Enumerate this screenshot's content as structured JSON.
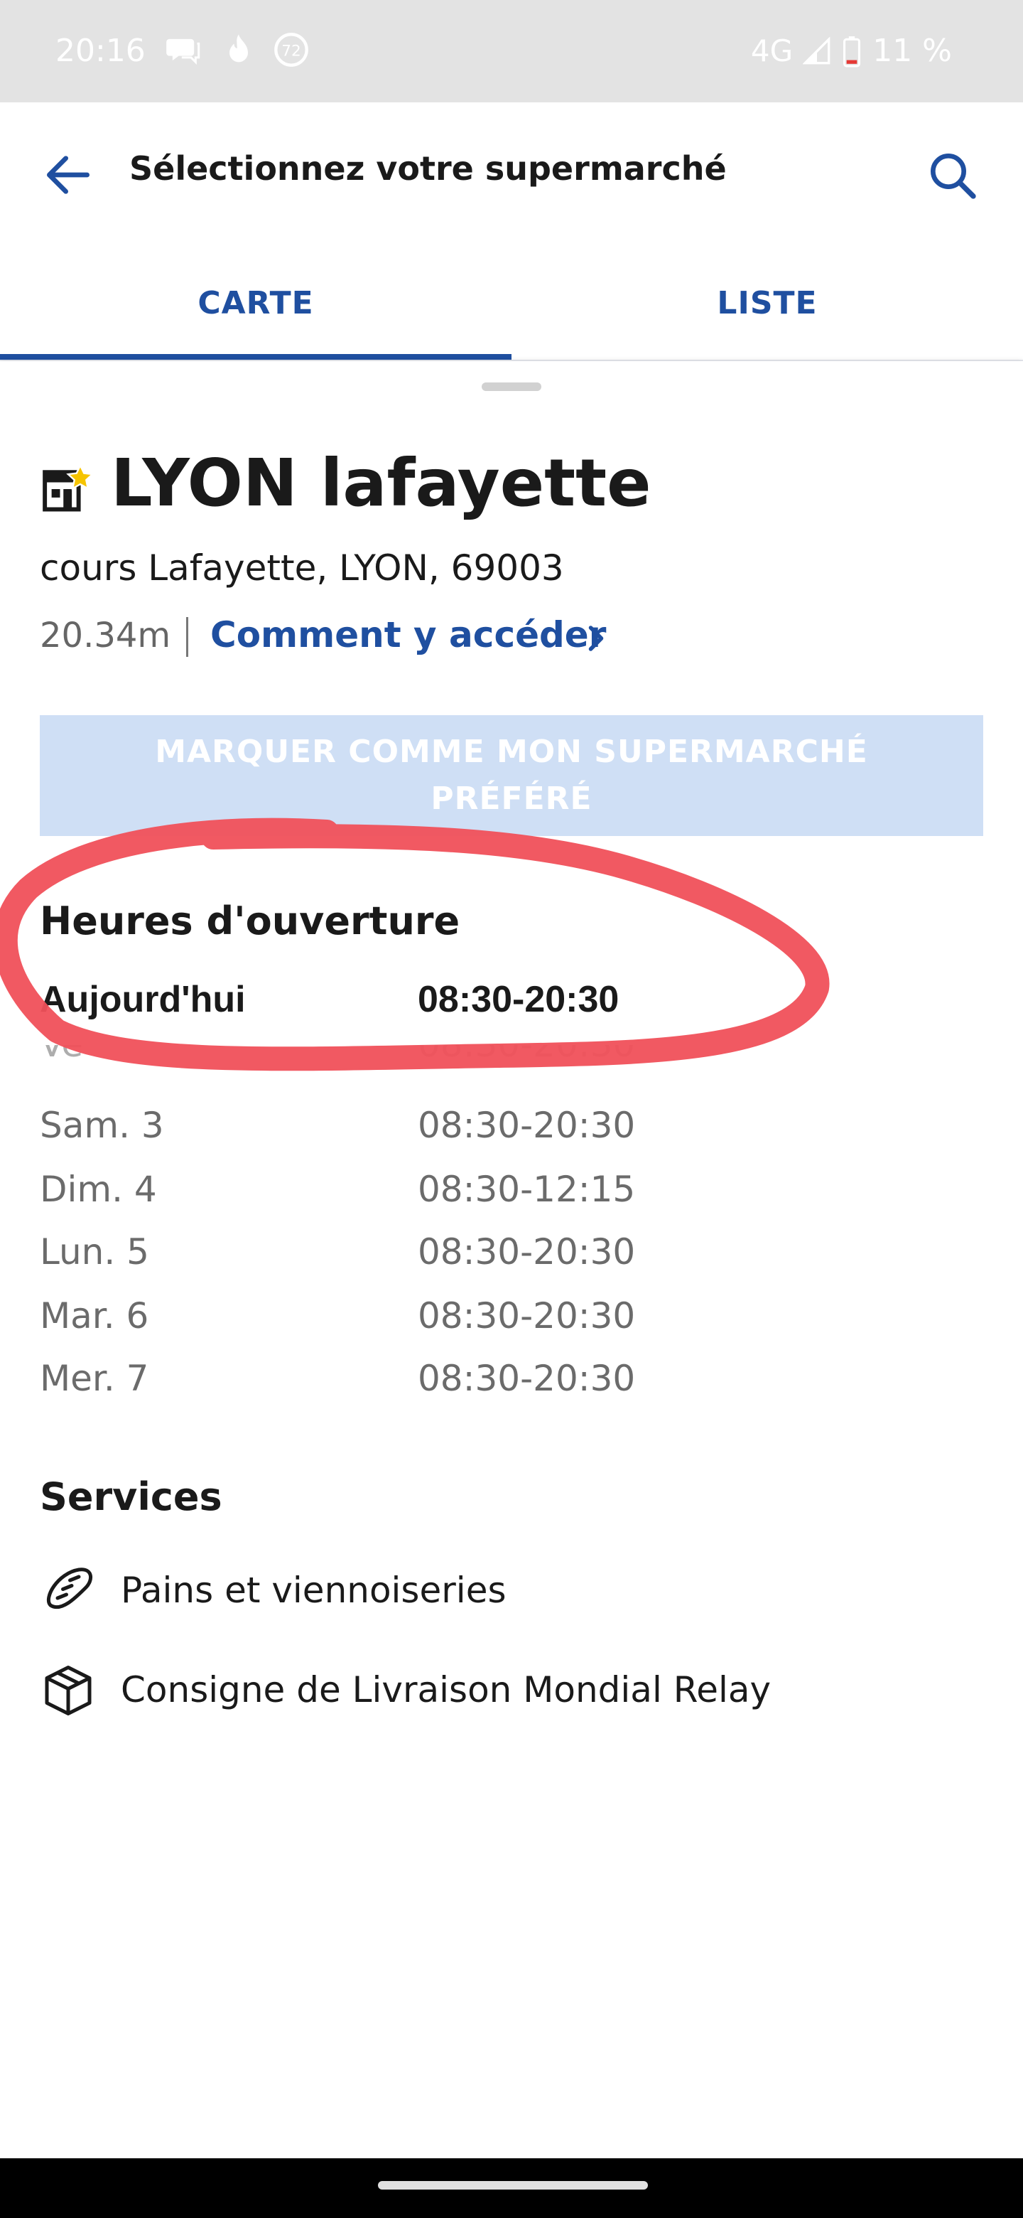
{
  "status_bar": {
    "time": "20:16",
    "notification_badge": "72",
    "network": "4G",
    "battery": "11 %"
  },
  "app_bar": {
    "title": "Sélectionnez votre supermarché"
  },
  "tabs": [
    {
      "label": "CARTE",
      "active": true
    },
    {
      "label": "LISTE",
      "active": false
    }
  ],
  "store": {
    "name": "LYON lafayette",
    "address": "cours Lafayette, LYON, 69003",
    "distance": "20.34m",
    "directions_label": "Comment y accéder",
    "favorite_button_label": "MARQUER COMME MON SUPERMARCHÉ PRÉFÉRÉ"
  },
  "hours": {
    "title": "Heures d'ouverture",
    "rows": [
      {
        "day": "Aujourd'hui",
        "time": "08:30-20:30"
      },
      {
        "day": "Ve",
        "time": "08:30-20:30"
      },
      {
        "day": "Sam. 3",
        "time": "08:30-20:30"
      },
      {
        "day": "Dim. 4",
        "time": "08:30-12:15"
      },
      {
        "day": "Lun. 5",
        "time": "08:30-20:30"
      },
      {
        "day": "Mar. 6",
        "time": "08:30-20:30"
      },
      {
        "day": "Mer. 7",
        "time": "08:30-20:30"
      }
    ]
  },
  "services": {
    "title": "Services",
    "items": [
      {
        "label": "Pains et viennoiseries",
        "icon": "bread-icon"
      },
      {
        "label": "Consigne de Livraison Mondial Relay",
        "icon": "package-icon"
      }
    ]
  },
  "colors": {
    "accent": "#1f4fa0",
    "button_bg": "#cfdff5",
    "annotation": "#f0505a"
  }
}
